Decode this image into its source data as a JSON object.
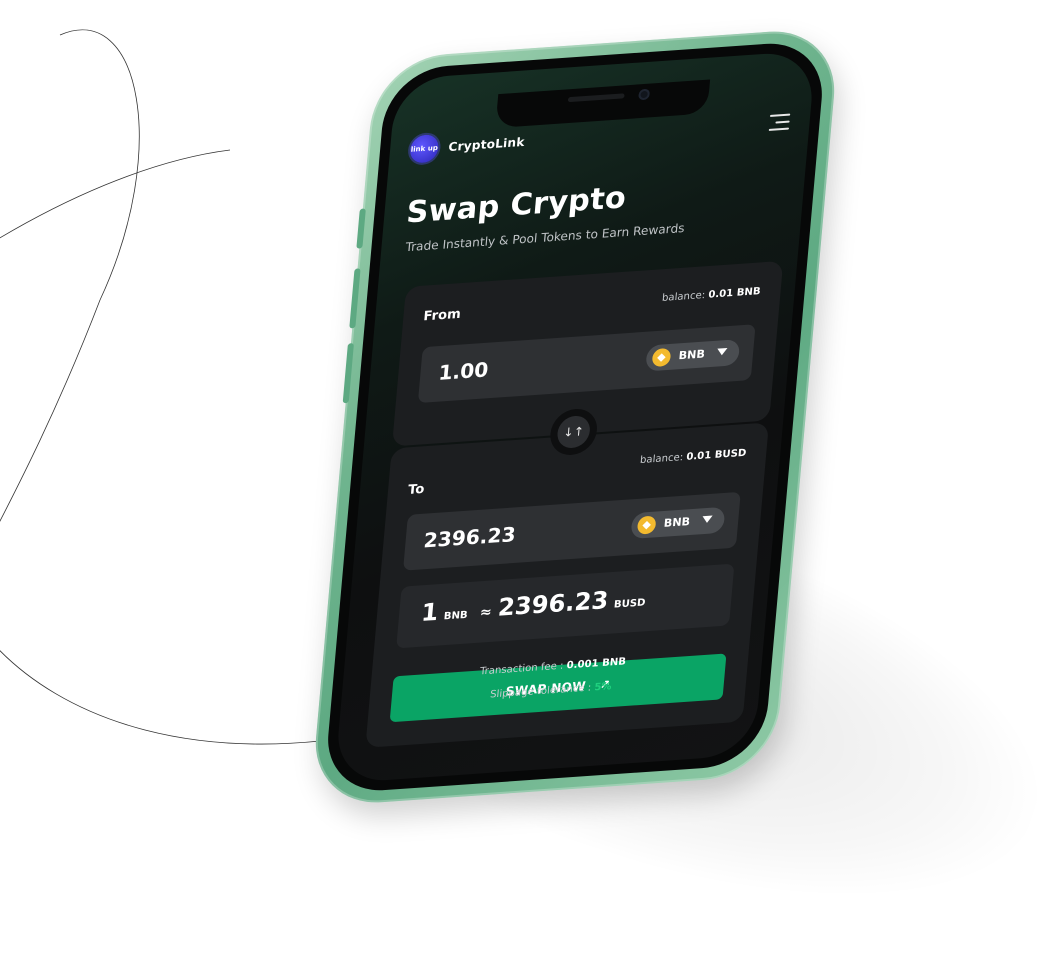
{
  "app": {
    "brand": "CryptoLink",
    "logo_text": "link up"
  },
  "hero": {
    "title": "Swap Crypto",
    "subtitle": "Trade Instantly & Pool Tokens to Earn Rewards"
  },
  "from": {
    "label": "From",
    "balance_label": "balance:",
    "balance_value": "0.01 BNB",
    "amount": "1.00",
    "token": "BNB"
  },
  "to": {
    "label": "To",
    "balance_label": "balance:",
    "balance_value": "0.01 BUSD",
    "amount": "2396.23",
    "token": "BNB"
  },
  "swap_toggle": {
    "glyph": "↓↑"
  },
  "rate": {
    "left_amount": "1",
    "left_unit": "BNB",
    "approx": "≈",
    "right_amount": "2396.23",
    "right_unit": "BUSD"
  },
  "actions": {
    "swap_label": "SWAP NOW",
    "swap_arrow": "↗"
  },
  "footer": {
    "fee_label": "Transaction fee :",
    "fee_value": "0.001 BNB",
    "slippage_label": "Slippage tolerance :",
    "slippage_value": "5%"
  },
  "colors": {
    "accent_green": "#0aa465",
    "slippage_green": "#20d07f",
    "bnb_yellow": "#f3ba2f",
    "logo_blue": "#5f57ff",
    "phone_frame": "#6fb48e"
  }
}
